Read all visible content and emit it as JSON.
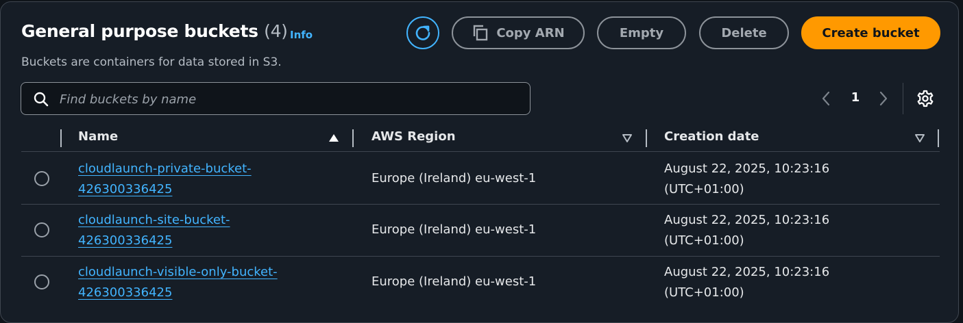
{
  "header": {
    "title": "General purpose buckets",
    "count": "(4)",
    "info_label": "Info",
    "description": "Buckets are containers for data stored in S3."
  },
  "actions": {
    "refresh_icon": "refresh-icon",
    "copy_arn_label": "Copy ARN",
    "copy_icon": "copy-icon",
    "empty_label": "Empty",
    "delete_label": "Delete",
    "create_label": "Create bucket"
  },
  "search": {
    "placeholder": "Find buckets by name",
    "value": ""
  },
  "pagination": {
    "current_page": "1"
  },
  "table": {
    "columns": [
      {
        "label": "Name",
        "sort": "ascending"
      },
      {
        "label": "AWS Region",
        "sort": "none"
      },
      {
        "label": "Creation date",
        "sort": "none"
      }
    ],
    "rows": [
      {
        "name": "cloudlaunch-private-bucket-426300336425",
        "region": "Europe (Ireland) eu-west-1",
        "created": "August 22, 2025, 10:23:16 (UTC+01:00)"
      },
      {
        "name": "cloudlaunch-site-bucket-426300336425",
        "region": "Europe (Ireland) eu-west-1",
        "created": "August 22, 2025, 10:23:16 (UTC+01:00)"
      },
      {
        "name": "cloudlaunch-visible-only-bucket-426300336425",
        "region": "Europe (Ireland) eu-west-1",
        "created": "August 22, 2025, 10:23:16 (UTC+01:00)"
      }
    ]
  },
  "colors": {
    "accent": "#42b4ff",
    "primary_button": "#ff9900",
    "panel_background": "#161d26"
  }
}
